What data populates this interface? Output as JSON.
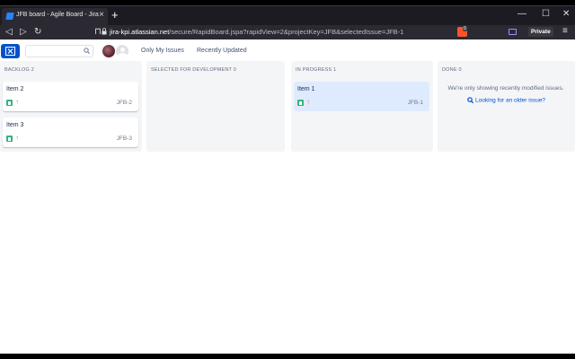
{
  "browser": {
    "tab_title": "JFB board - Agile Board - Jira",
    "tab_close": "×",
    "new_tab": "+",
    "window_controls": {
      "minimize": "—",
      "maximize": "☐",
      "close": "✕"
    },
    "nav": {
      "back": "◁",
      "forward": "▷",
      "reload": "↻",
      "bookmark": "⊓"
    },
    "url_host": "jira-kpi.atlassian.net",
    "url_path": "/secure/RapidBoard.jspa?rapidView=2&projectKey=JFB&selectedIssue=JFB-1",
    "shield_badge": "0",
    "private_label": "Private",
    "menu_icon": "≡"
  },
  "header": {
    "search_placeholder": "",
    "filters": [
      "Only My Issues",
      "Recently Updated"
    ]
  },
  "columns": [
    {
      "title": "BACKLOG",
      "count": "2",
      "cards": [
        {
          "summary": "Item 2",
          "key": "JFB-2",
          "priority_icon": "↑"
        },
        {
          "summary": "Item 3",
          "key": "JFB-3",
          "priority_icon": "↑"
        }
      ]
    },
    {
      "title": "SELECTED FOR DEVELOPMENT",
      "count": "0",
      "cards": []
    },
    {
      "title": "IN PROGRESS",
      "count": "1",
      "cards": [
        {
          "summary": "Item 1",
          "key": "JFB-1",
          "priority_icon": "↑",
          "selected": true
        }
      ]
    },
    {
      "title": "DONE",
      "count": "0",
      "cards": [],
      "message": "We're only showing recently modified issues.",
      "link": "Looking for an older issue?"
    }
  ],
  "colors": {
    "jira_blue": "#0052cc",
    "column_bg": "#f4f5f7",
    "selected_card": "#deebff",
    "story_green": "#36b37e",
    "priority_orange": "#ff7452"
  }
}
